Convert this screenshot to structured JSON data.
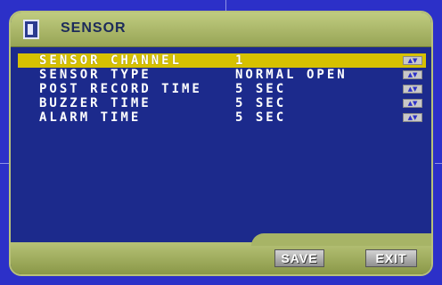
{
  "header": {
    "title": "SENSOR"
  },
  "settings": [
    {
      "label": "SENSOR CHANNEL",
      "value": "1",
      "selected": true
    },
    {
      "label": "SENSOR TYPE",
      "value": "NORMAL OPEN",
      "selected": false
    },
    {
      "label": "POST RECORD TIME",
      "value": "5 SEC",
      "selected": false
    },
    {
      "label": "BUZZER TIME",
      "value": "5 SEC",
      "selected": false
    },
    {
      "label": "ALARM TIME",
      "value": "5 SEC",
      "selected": false
    }
  ],
  "buttons": {
    "save": "SAVE",
    "exit": "EXIT"
  },
  "icons": {
    "title": "sensor-menu-icon",
    "row_adjust": "up-down-arrows-icon"
  },
  "colors": {
    "background": "#2c30c8",
    "panel": "#1c2a8c",
    "selection": "#d6c100",
    "chrome": "#b9c27a"
  }
}
